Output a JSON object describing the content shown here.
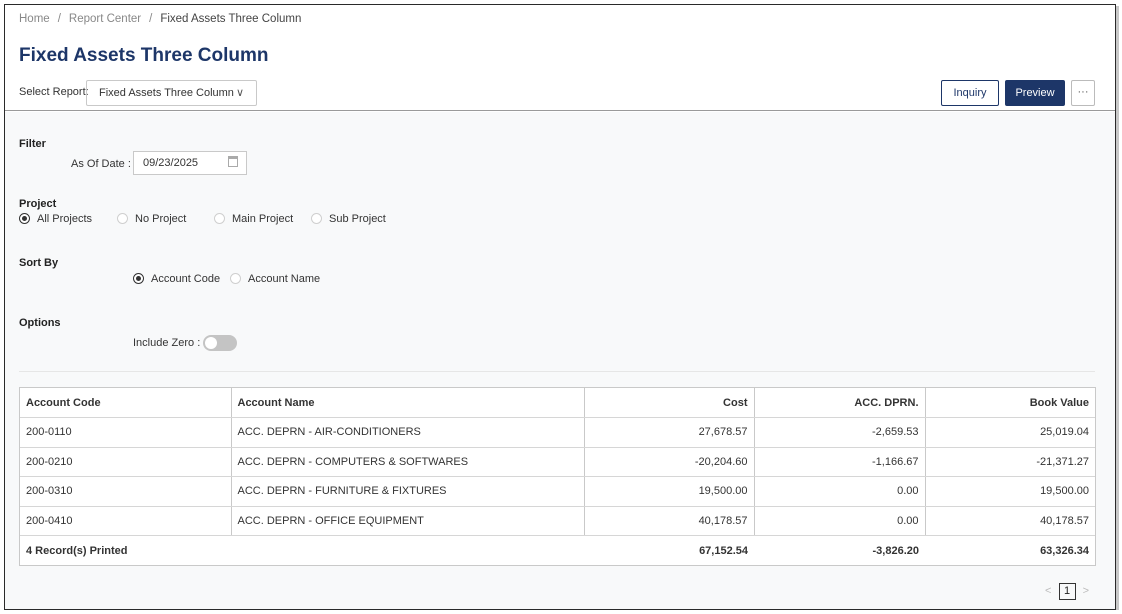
{
  "breadcrumb": {
    "home": "Home",
    "separator": "/",
    "report_center": "Report Center",
    "current": "Fixed Assets Three Column"
  },
  "page_title": "Fixed Assets Three Column",
  "select_report": {
    "label": "Select Report:",
    "value": "Fixed Assets Three Column",
    "chevron": "∨"
  },
  "actions": {
    "inquiry": "Inquiry",
    "preview": "Preview",
    "more": "···"
  },
  "filter": {
    "title": "Filter",
    "as_of_label": "As Of Date :",
    "as_of_value": "09/23/2025"
  },
  "project": {
    "title": "Project",
    "options": [
      {
        "label": "All Projects",
        "selected": true
      },
      {
        "label": "No Project",
        "selected": false
      },
      {
        "label": "Main Project",
        "selected": false
      },
      {
        "label": "Sub Project",
        "selected": false
      }
    ]
  },
  "sort_by": {
    "title": "Sort By",
    "options": [
      {
        "label": "Account Code",
        "selected": true
      },
      {
        "label": "Account Name",
        "selected": false
      }
    ]
  },
  "options": {
    "title": "Options",
    "include_zero_label": "Include Zero :",
    "include_zero_on": false
  },
  "table": {
    "headers": [
      "Account Code",
      "Account Name",
      "Cost",
      "ACC. DPRN.",
      "Book Value"
    ],
    "rows": [
      [
        "200-0110",
        "ACC. DEPRN - AIR-CONDITIONERS",
        "27,678.57",
        "-2,659.53",
        "25,019.04"
      ],
      [
        "200-0210",
        "ACC. DEPRN - COMPUTERS & SOFTWARES",
        "-20,204.60",
        "-1,166.67",
        "-21,371.27"
      ],
      [
        "200-0310",
        "ACC. DEPRN - FURNITURE & FIXTURES",
        "19,500.00",
        "0.00",
        "19,500.00"
      ],
      [
        "200-0410",
        "ACC. DEPRN - OFFICE EQUIPMENT",
        "40,178.57",
        "0.00",
        "40,178.57"
      ]
    ],
    "totals": {
      "label": "4 Record(s) Printed",
      "cost": "67,152.54",
      "acc_dprn": "-3,826.20",
      "book_value": "63,326.34"
    }
  },
  "pagination": {
    "prev": "<",
    "current_page": "1",
    "next": ">"
  },
  "colors": {
    "brand": "#1d3668",
    "background": "#f8f9fa",
    "border": "#c9c9c9"
  },
  "icons": [
    "calendar-icon",
    "chevron-down-icon",
    "more-icon",
    "chevron-left-icon",
    "chevron-right-icon"
  ]
}
